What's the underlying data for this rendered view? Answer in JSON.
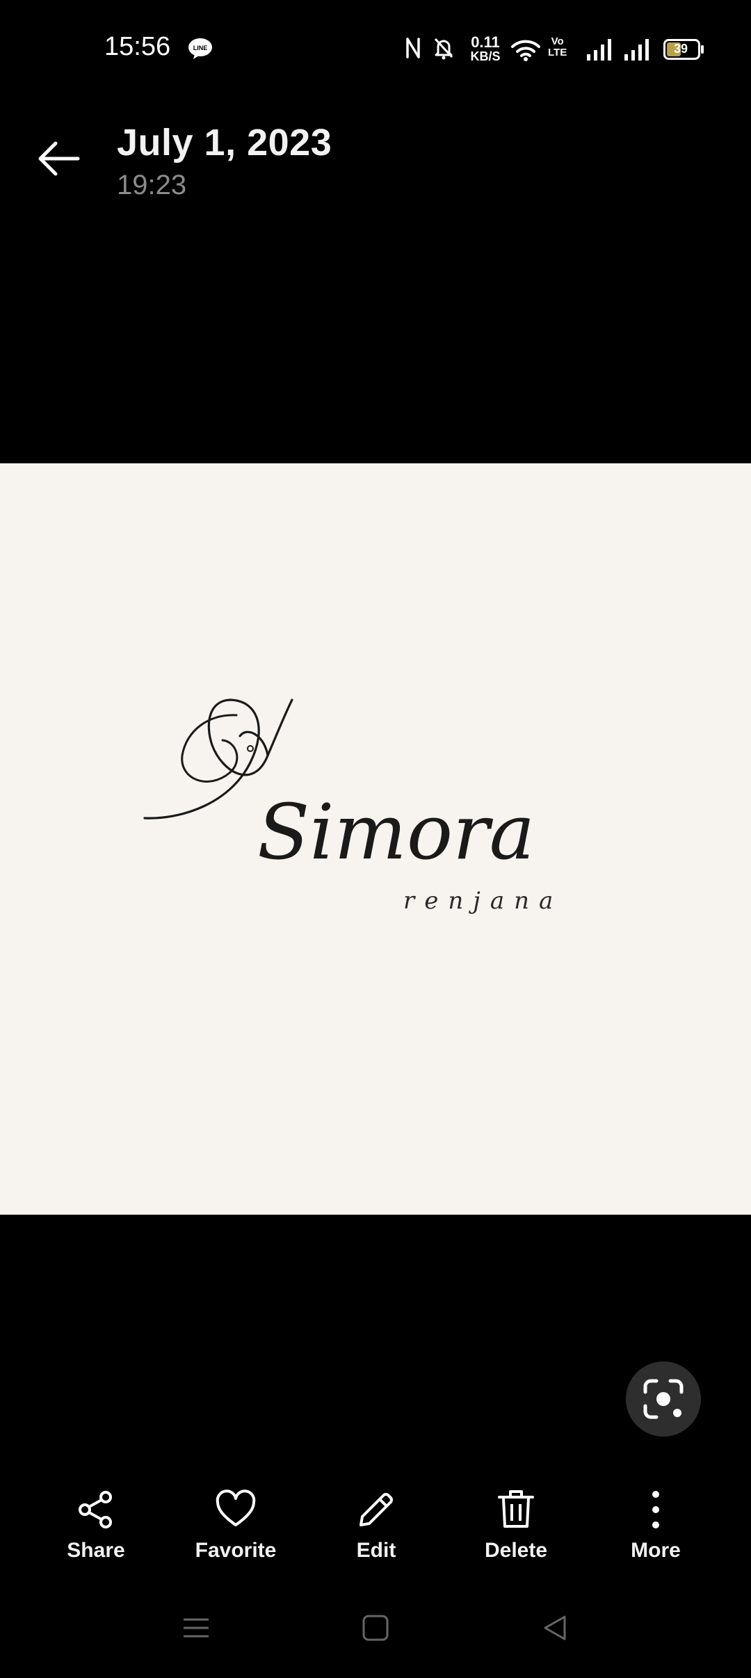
{
  "status_bar": {
    "time": "15:56",
    "net_speed_value": "0.11",
    "net_speed_unit": "KB/S",
    "volte_top": "Vo",
    "volte_bottom": "LTE",
    "battery": "39",
    "icons": [
      "line-app-icon",
      "nfc-icon",
      "mute-bell-icon",
      "wifi-icon",
      "signal-icon",
      "signal-icon",
      "battery-icon"
    ]
  },
  "header": {
    "title": "July 1, 2023",
    "subtitle": "19:23",
    "back_icon": "back-arrow-icon"
  },
  "photo": {
    "logo_title": "Simora",
    "logo_tagline": "renjana",
    "background": "#f7f4ef"
  },
  "lens": {
    "icon": "lens-search-icon"
  },
  "actions": [
    {
      "label": "Share",
      "icon": "share-icon"
    },
    {
      "label": "Favorite",
      "icon": "heart-icon"
    },
    {
      "label": "Edit",
      "icon": "pencil-icon"
    },
    {
      "label": "Delete",
      "icon": "trash-icon"
    },
    {
      "label": "More",
      "icon": "more-vertical-icon"
    }
  ],
  "nav": {
    "icons": [
      "menu-lines-icon",
      "home-square-icon",
      "back-triangle-icon"
    ]
  }
}
